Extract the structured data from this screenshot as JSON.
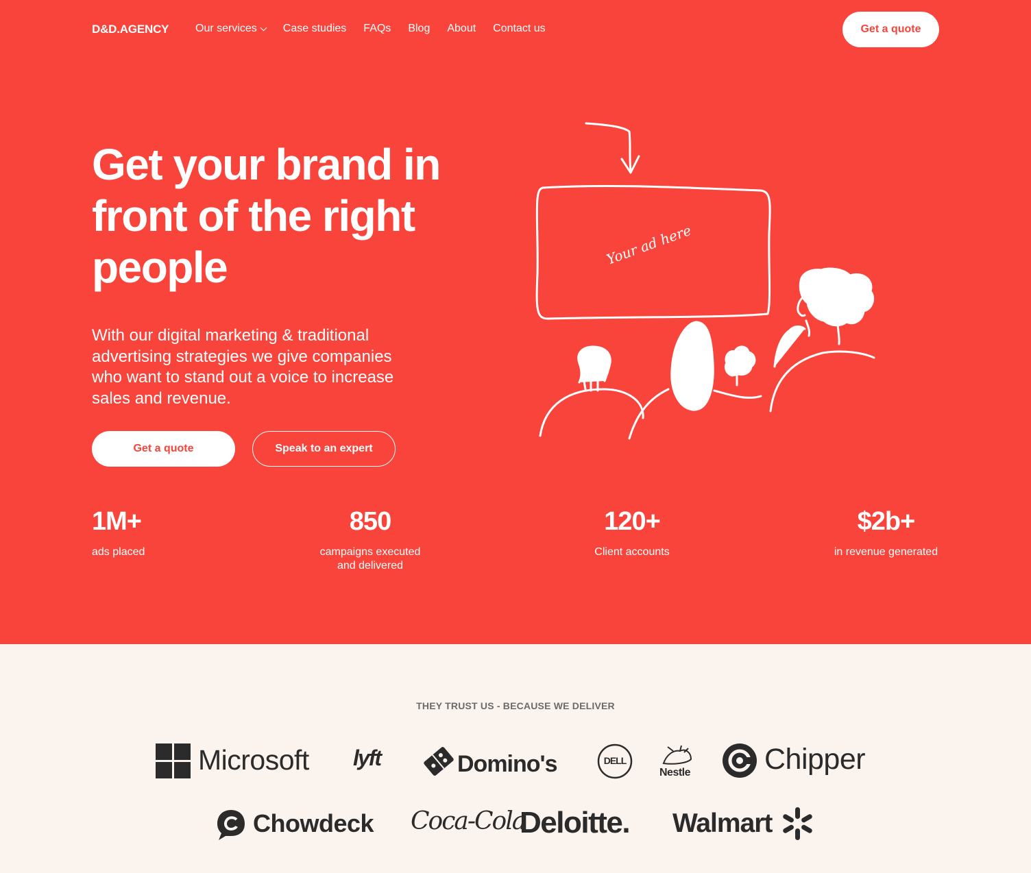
{
  "nav": {
    "logo": "D&D.AGENCY",
    "items": [
      "Our services",
      "Case studies",
      "FAQs",
      "Blog",
      "About",
      "Contact us"
    ],
    "cta": "Get a quote"
  },
  "hero": {
    "title": "Get your brand in front of the right people",
    "subtitle": "With our digital marketing & traditional advertising strategies we give companies who want to stand out a voice to increase sales and revenue.",
    "primary_button": "Get a quote",
    "secondary_button": "Speak to an expert",
    "illustration_caption": "Your ad here"
  },
  "stats": [
    {
      "value": "1M+",
      "label": "ads placed"
    },
    {
      "value": "850",
      "label": "campaigns executed and delivered"
    },
    {
      "value": "120+",
      "label": "Client accounts"
    },
    {
      "value": "$2b+",
      "label": "in revenue generated"
    }
  ],
  "trust": {
    "title": "THEY TRUST US - BECAUSE WE DELIVER",
    "logos": [
      "Microsoft",
      "lyft",
      "Domino's",
      "DELL",
      "Nestle",
      "Chipper",
      "Chowdeck",
      "Coca-Cola",
      "Deloitte.",
      "Walmart"
    ]
  },
  "colors": {
    "brand_red": "#f8443b",
    "cream": "#fbf3ee",
    "logo_gray": "#2b2b2b"
  }
}
